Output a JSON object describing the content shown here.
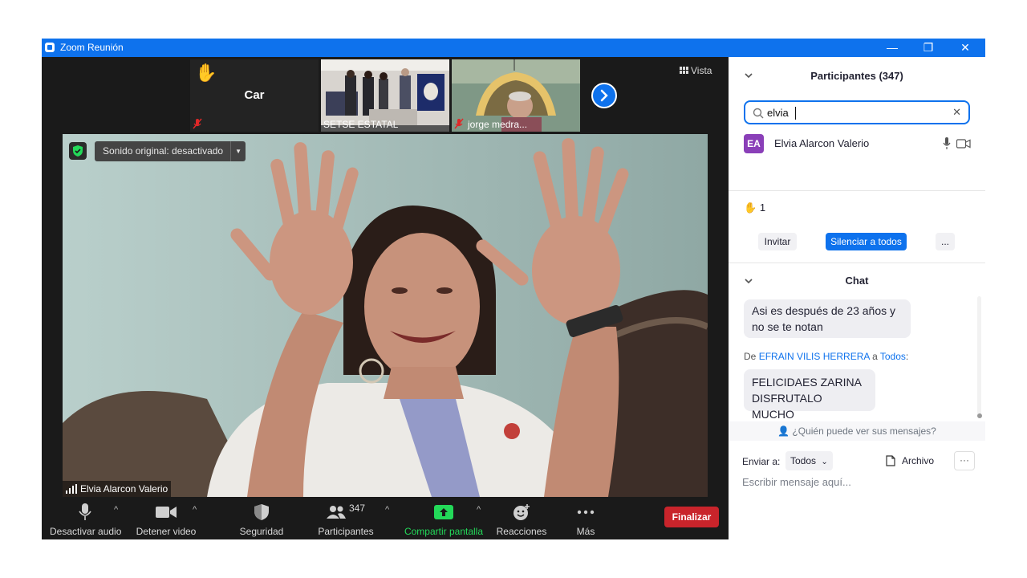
{
  "window": {
    "title": "Zoom Reunión",
    "minimize_glyph": "—",
    "restore_glyph": "❐",
    "close_glyph": "✕"
  },
  "top_strip": {
    "view_label": "Vista",
    "next_arrow_icon": "chevron-right-icon",
    "thumbnails": [
      {
        "name": "Car",
        "raised_hand": true,
        "muted": true
      },
      {
        "name": "SETSE ESTATAL",
        "muted": false
      },
      {
        "name": "jorge medra...",
        "muted": true
      }
    ]
  },
  "main_video": {
    "security_badge": "shield-check-icon",
    "original_sound_label": "Sonido original: desactivado",
    "speaker_name": "Elvia Alarcon Valerio"
  },
  "toolbar": {
    "mute_label": "Desactivar audio",
    "video_label": "Detener video",
    "security_label": "Seguridad",
    "participants_label": "Participantes",
    "participants_count": "347",
    "share_label": "Compartir pantalla",
    "reactions_label": "Reacciones",
    "more_label": "Más",
    "end_label": "Finalizar",
    "colors": {
      "share": "#23d959",
      "end": "#e02828"
    }
  },
  "participants_panel": {
    "title": "Participantes (347)",
    "search_value": "elvia",
    "results": [
      {
        "initials": "EA",
        "name": "Elvia Alarcon Valerio",
        "avatar_color": "#8a3fb8"
      }
    ],
    "raised_hands_count": "1",
    "invite_label": "Invitar",
    "mute_all_label": "Silenciar a todos",
    "more_label": "..."
  },
  "chat": {
    "title": "Chat",
    "messages": [
      {
        "text_line1": "Asi es después de 23  años y",
        "text_line2": "no se te notan"
      },
      {
        "from_prefix": "De ",
        "sender": "EFRAIN VILIS HERRERA",
        "to_prefix": " a ",
        "recipient": "Todos",
        "suffix": ":",
        "text_line1": "FELICIDAES ZARINA",
        "text_line2": "DISFRUTALO MUCHO"
      }
    ],
    "who_can_see": "¿Quién puede ver sus mensajes?",
    "send_to_label": "Enviar a:",
    "send_to_value": "Todos",
    "file_label": "Archivo",
    "more_label": "···",
    "input_placeholder": "Escribir mensaje aquí..."
  }
}
